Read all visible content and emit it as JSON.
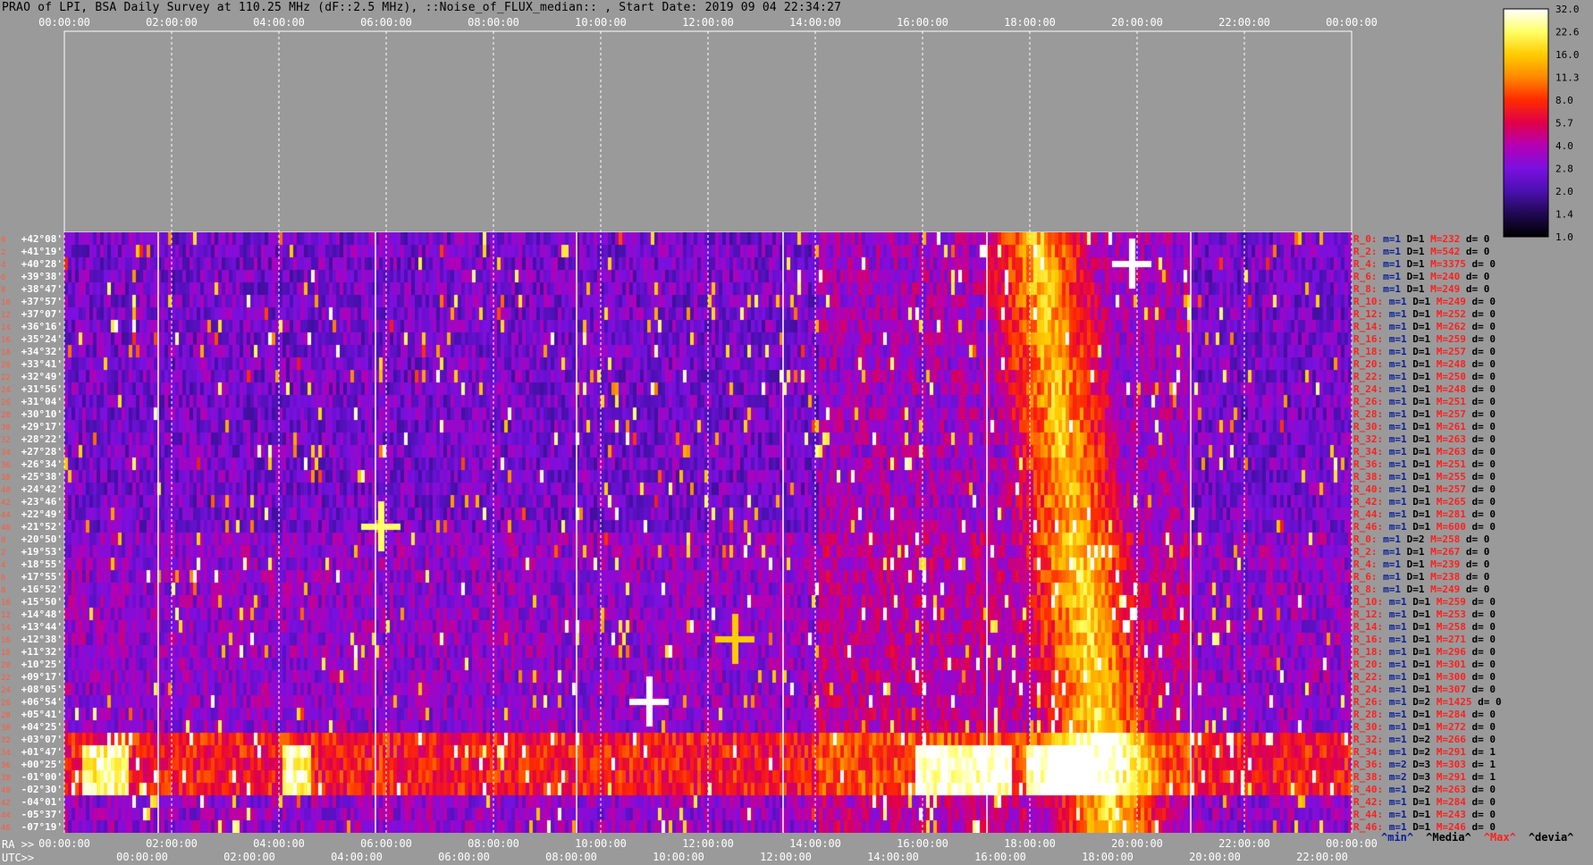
{
  "title": "PRAO of LPI, BSA Daily Survey at 110.25 MHz (dF::2.5 MHz), ::Noise_of_FLUX_median:: , Start Date: 2019 09 04 22:34:27",
  "chart_data": {
    "type": "heatmap",
    "title": "PRAO of LPI, BSA Daily Survey at 110.25 MHz (dF::2.5 MHz), ::Noise_of_FLUX_median:: , Start Date: 2019 09 04 22:34:27",
    "x_axis_top_ticks": [
      "00:00:00",
      "02:00:00",
      "04:00:00",
      "06:00:00",
      "08:00:00",
      "10:00:00",
      "12:00:00",
      "14:00:00",
      "16:00:00",
      "18:00:00",
      "20:00:00",
      "22:00:00",
      "00:00:00"
    ],
    "x_axis_ra_label": "RA >>",
    "x_axis_ra_ticks": [
      "00:00:00",
      "02:00:00",
      "04:00:00",
      "06:00:00",
      "08:00:00",
      "10:00:00",
      "12:00:00",
      "14:00:00",
      "16:00:00",
      "18:00:00",
      "20:00:00",
      "22:00:00",
      "00:00:00"
    ],
    "x_axis_utc_label": "UTC>>",
    "x_axis_utc_ticks": [
      "00:00:00",
      "02:00:00",
      "04:00:00",
      "06:00:00",
      "08:00:00",
      "10:00:00",
      "12:00:00",
      "14:00:00",
      "16:00:00",
      "18:00:00",
      "20:00:00",
      "22:00:00"
    ],
    "rows": [
      {
        "idx": "0",
        "dec": "+42°08'",
        "stat": "R_0:",
        "m": "m=1",
        "D": "D=1",
        "M": "M=232",
        "d": "d= 0"
      },
      {
        "idx": "2",
        "dec": "+41°19'",
        "stat": "R_2:",
        "m": "m=1",
        "D": "D=1",
        "M": "M=542",
        "d": "d= 0"
      },
      {
        "idx": "4",
        "dec": "+40°28'",
        "stat": "R_4:",
        "m": "m=1",
        "D": "D=1",
        "M": "M=3375",
        "d": "d= 0"
      },
      {
        "idx": "6",
        "dec": "+39°38'",
        "stat": "R_6:",
        "m": "m=1",
        "D": "D=1",
        "M": "M=240",
        "d": "d= 0"
      },
      {
        "idx": "8",
        "dec": "+38°47'",
        "stat": "R_8:",
        "m": "m=1",
        "D": "D=1",
        "M": "M=249",
        "d": "d= 0"
      },
      {
        "idx": "10",
        "dec": "+37°57'",
        "stat": "R_10:",
        "m": "m=1",
        "D": "D=1",
        "M": "M=249",
        "d": "d= 0"
      },
      {
        "idx": "12",
        "dec": "+37°07'",
        "stat": "R_12:",
        "m": "m=1",
        "D": "D=1",
        "M": "M=252",
        "d": "d= 0"
      },
      {
        "idx": "14",
        "dec": "+36°16'",
        "stat": "R_14:",
        "m": "m=1",
        "D": "D=1",
        "M": "M=262",
        "d": "d= 0"
      },
      {
        "idx": "16",
        "dec": "+35°24'",
        "stat": "R_16:",
        "m": "m=1",
        "D": "D=1",
        "M": "M=259",
        "d": "d= 0"
      },
      {
        "idx": "18",
        "dec": "+34°32'",
        "stat": "R_18:",
        "m": "m=1",
        "D": "D=1",
        "M": "M=257",
        "d": "d= 0"
      },
      {
        "idx": "20",
        "dec": "+33°41'",
        "stat": "R_20:",
        "m": "m=1",
        "D": "D=1",
        "M": "M=248",
        "d": "d= 0"
      },
      {
        "idx": "22",
        "dec": "+32°49'",
        "stat": "R_22:",
        "m": "m=1",
        "D": "D=1",
        "M": "M=250",
        "d": "d= 0"
      },
      {
        "idx": "24",
        "dec": "+31°56'",
        "stat": "R_24:",
        "m": "m=1",
        "D": "D=1",
        "M": "M=248",
        "d": "d= 0"
      },
      {
        "idx": "26",
        "dec": "+31°04'",
        "stat": "R_26:",
        "m": "m=1",
        "D": "D=1",
        "M": "M=251",
        "d": "d= 0"
      },
      {
        "idx": "28",
        "dec": "+30°10'",
        "stat": "R_28:",
        "m": "m=1",
        "D": "D=1",
        "M": "M=257",
        "d": "d= 0"
      },
      {
        "idx": "30",
        "dec": "+29°17'",
        "stat": "R_30:",
        "m": "m=1",
        "D": "D=1",
        "M": "M=261",
        "d": "d= 0"
      },
      {
        "idx": "32",
        "dec": "+28°22'",
        "stat": "R_32:",
        "m": "m=1",
        "D": "D=1",
        "M": "M=263",
        "d": "d= 0"
      },
      {
        "idx": "34",
        "dec": "+27°28'",
        "stat": "R_34:",
        "m": "m=1",
        "D": "D=1",
        "M": "M=263",
        "d": "d= 0"
      },
      {
        "idx": "36",
        "dec": "+26°34'",
        "stat": "R_36:",
        "m": "m=1",
        "D": "D=1",
        "M": "M=251",
        "d": "d= 0"
      },
      {
        "idx": "38",
        "dec": "+25°38'",
        "stat": "R_38:",
        "m": "m=1",
        "D": "D=1",
        "M": "M=255",
        "d": "d= 0"
      },
      {
        "idx": "40",
        "dec": "+24°42'",
        "stat": "R_40:",
        "m": "m=1",
        "D": "D=1",
        "M": "M=257",
        "d": "d= 0"
      },
      {
        "idx": "42",
        "dec": "+23°46'",
        "stat": "R_42:",
        "m": "m=1",
        "D": "D=1",
        "M": "M=265",
        "d": "d= 0"
      },
      {
        "idx": "44",
        "dec": "+22°49'",
        "stat": "R_44:",
        "m": "m=1",
        "D": "D=1",
        "M": "M=281",
        "d": "d= 0"
      },
      {
        "idx": "46",
        "dec": "+21°52'",
        "stat": "R_46:",
        "m": "m=1",
        "D": "D=1",
        "M": "M=600",
        "d": "d= 0"
      },
      {
        "idx": "0",
        "dec": "+20°50'",
        "stat": "R_0:",
        "m": "m=1",
        "D": "D=2",
        "M": "M=258",
        "d": "d= 0"
      },
      {
        "idx": "2",
        "dec": "+19°53'",
        "stat": "R_2:",
        "m": "m=1",
        "D": "D=1",
        "M": "M=267",
        "d": "d= 0"
      },
      {
        "idx": "4",
        "dec": "+18°55'",
        "stat": "R_4:",
        "m": "m=1",
        "D": "D=1",
        "M": "M=239",
        "d": "d= 0"
      },
      {
        "idx": "6",
        "dec": "+17°55'",
        "stat": "R_6:",
        "m": "m=1",
        "D": "D=1",
        "M": "M=238",
        "d": "d= 0"
      },
      {
        "idx": "8",
        "dec": "+16°52'",
        "stat": "R_8:",
        "m": "m=1",
        "D": "D=1",
        "M": "M=249",
        "d": "d= 0"
      },
      {
        "idx": "10",
        "dec": "+15°50'",
        "stat": "R_10:",
        "m": "m=1",
        "D": "D=1",
        "M": "M=259",
        "d": "d= 0"
      },
      {
        "idx": "12",
        "dec": "+14°48'",
        "stat": "R_12:",
        "m": "m=1",
        "D": "D=1",
        "M": "M=253",
        "d": "d= 0"
      },
      {
        "idx": "14",
        "dec": "+13°44'",
        "stat": "R_14:",
        "m": "m=1",
        "D": "D=1",
        "M": "M=258",
        "d": "d= 0"
      },
      {
        "idx": "16",
        "dec": "+12°38'",
        "stat": "R_16:",
        "m": "m=1",
        "D": "D=1",
        "M": "M=271",
        "d": "d= 0"
      },
      {
        "idx": "18",
        "dec": "+11°32'",
        "stat": "R_18:",
        "m": "m=1",
        "D": "D=1",
        "M": "M=296",
        "d": "d= 0"
      },
      {
        "idx": "20",
        "dec": "+10°25'",
        "stat": "R_20:",
        "m": "m=1",
        "D": "D=1",
        "M": "M=301",
        "d": "d= 0"
      },
      {
        "idx": "22",
        "dec": "+09°17'",
        "stat": "R_22:",
        "m": "m=1",
        "D": "D=1",
        "M": "M=300",
        "d": "d= 0"
      },
      {
        "idx": "24",
        "dec": "+08°05'",
        "stat": "R_24:",
        "m": "m=1",
        "D": "D=1",
        "M": "M=307",
        "d": "d= 0"
      },
      {
        "idx": "26",
        "dec": "+06°54'",
        "stat": "R_26:",
        "m": "m=1",
        "D": "D=2",
        "M": "M=1425",
        "d": "d= 0"
      },
      {
        "idx": "28",
        "dec": "+05°41'",
        "stat": "R_28:",
        "m": "m=1",
        "D": "D=1",
        "M": "M=284",
        "d": "d= 0"
      },
      {
        "idx": "30",
        "dec": "+04°25'",
        "stat": "R_30:",
        "m": "m=1",
        "D": "D=1",
        "M": "M=272",
        "d": "d= 0"
      },
      {
        "idx": "32",
        "dec": "+03°07'",
        "stat": "R_32:",
        "m": "m=1",
        "D": "D=2",
        "M": "M=266",
        "d": "d= 0"
      },
      {
        "idx": "34",
        "dec": "+01°47'",
        "stat": "R_34:",
        "m": "m=1",
        "D": "D=2",
        "M": "M=291",
        "d": "d= 1"
      },
      {
        "idx": "36",
        "dec": "+00°25'",
        "stat": "R_36:",
        "m": "m=2",
        "D": "D=3",
        "M": "M=303",
        "d": "d= 1"
      },
      {
        "idx": "38",
        "dec": "-01°00'",
        "stat": "R_38:",
        "m": "m=2",
        "D": "D=3",
        "M": "M=291",
        "d": "d= 1"
      },
      {
        "idx": "40",
        "dec": "-02°30'",
        "stat": "R_40:",
        "m": "m=1",
        "D": "D=2",
        "M": "M=263",
        "d": "d= 0"
      },
      {
        "idx": "42",
        "dec": "-04°01'",
        "stat": "R_42:",
        "m": "m=1",
        "D": "D=1",
        "M": "M=284",
        "d": "d= 0"
      },
      {
        "idx": "44",
        "dec": "-05°37'",
        "stat": "R_44:",
        "m": "m=1",
        "D": "D=1",
        "M": "M=243",
        "d": "d= 0"
      },
      {
        "idx": "46",
        "dec": "-07°19'",
        "stat": "R_46:",
        "m": "m=1",
        "D": "D=1",
        "M": "M=246",
        "d": "d= 0"
      }
    ],
    "colorbar": {
      "ticks": [
        "32.0",
        "22.6",
        "16.0",
        "11.3",
        "8.0",
        "5.7",
        "4.0",
        "2.8",
        "2.0",
        "1.4",
        "1.0"
      ],
      "stops": [
        "#ffffff",
        "#ffff66",
        "#ffcc00",
        "#ff8800",
        "#ff2a00",
        "#e0004a",
        "#b400b4",
        "#7a10e0",
        "#4a10b0",
        "#200850",
        "#000000"
      ]
    },
    "stats_legend": [
      {
        "label": "^min^",
        "color": "#0a1f9c"
      },
      {
        "label": "^Media^",
        "color": "#000000"
      },
      {
        "label": "^Max^",
        "color": "#ff2020"
      },
      {
        "label": "^devia^",
        "color": "#000000"
      }
    ],
    "stat_colors": {
      "name": "#ff2020",
      "m": "#0a1f9c",
      "D": "#000000",
      "M": "#ff2020",
      "d": "#000000"
    },
    "bright_sources": [
      {
        "ra_hours": 19.9,
        "dec_row": 2,
        "intensity": 32,
        "label": ""
      },
      {
        "ra_hours": 10.9,
        "dec_row": 37,
        "intensity": 32,
        "label": ""
      },
      {
        "ra_hours": 12.5,
        "dec_row": 32,
        "intensity": 16,
        "label": ""
      },
      {
        "ra_hours": 5.9,
        "dec_row": 23,
        "intensity": 22.6,
        "label": ""
      }
    ]
  }
}
